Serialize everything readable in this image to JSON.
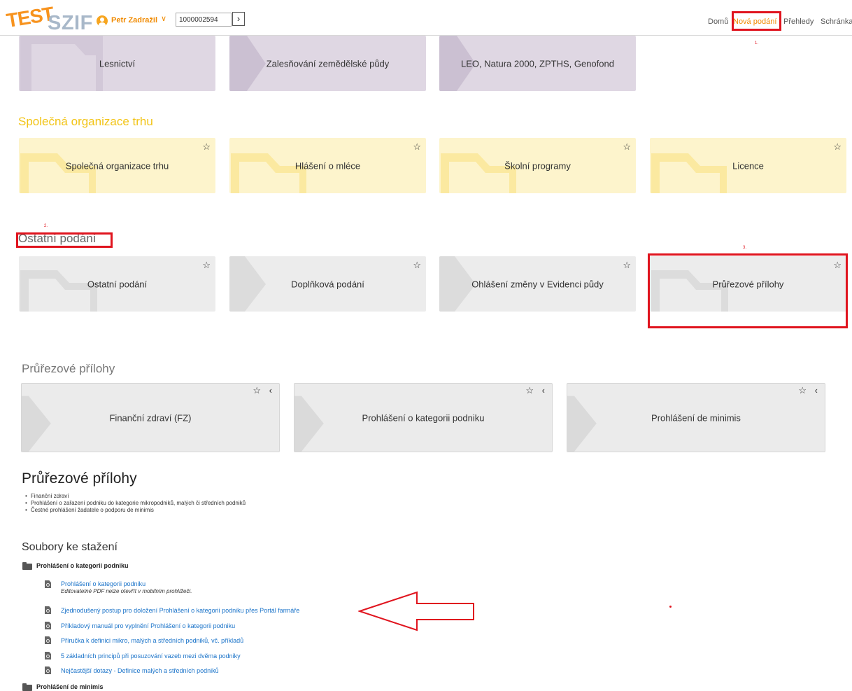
{
  "header": {
    "logo_test": "TEST",
    "logo_szif": "SZIF",
    "user_name": "Petr Zadražil",
    "client_id": "1000002594",
    "nav": [
      "Domů",
      "Nová podání",
      "Přehledy",
      "Schránka"
    ]
  },
  "annotations": {
    "a1": "1.",
    "a2": "2.",
    "a3": "3."
  },
  "top_tiles": [
    "Lesnictví",
    "Zalesňování zemědělské půdy",
    "LEO, Natura 2000, ZPTHS, Genofond"
  ],
  "sot": {
    "title": "Společná organizace trhu",
    "tiles": [
      "Společná organizace trhu",
      "Hlášení o mléce",
      "Školní programy",
      "Licence"
    ]
  },
  "ostatni": {
    "title": "Ostatní podání",
    "tiles": [
      "Ostatní podání",
      "Doplňková podání",
      "Ohlášení změny v Evidenci půdy",
      "Průřezové přílohy"
    ]
  },
  "prurezove": {
    "title": "Průřezové přílohy",
    "tiles": [
      "Finanční zdraví (FZ)",
      "Prohlášení o kategorii podniku",
      "Prohlášení de minimis"
    ]
  },
  "info": {
    "title": "Průřezové přílohy",
    "bullets": [
      "Finanční zdraví",
      "Prohlášení o zařazení podniku do kategorie mikropodniků, malých či středních podniků",
      "Čestné prohlášení žadatele o podporu de minimis"
    ]
  },
  "downloads": {
    "title": "Soubory ke stažení",
    "group1": "Prohlášení o kategorii podniku",
    "note": "Editovatelné PDF nelze otevřít v mobilním prohlížeči.",
    "links": [
      "Prohlášení o kategorii podniku",
      "Zjednodušený postup pro doložení Prohlášení o kategorii podniku přes Portál farmáře",
      "Příkladový manuál pro vyplnění Prohlášení o kategorii podniku",
      "Příručka k definici mikro, malých a středních podniků, vč. příkladů",
      "5 základních principů při posuzování vazeb mezi dvěma podniky",
      "Nejčastější dotazy - Definice malých a středních podniků"
    ],
    "group2": "Prohlášení de minimis"
  },
  "colors": {
    "accent_orange": "#f08a00",
    "highlight_red": "#e0141e",
    "link_blue": "#1a73c9",
    "sot_yellow": "#f2c417"
  },
  "icons": [
    "user-icon",
    "chevron-down-icon",
    "arrow-right-icon",
    "star-icon",
    "chevron-left-icon",
    "folder-icon",
    "pdf-icon"
  ]
}
